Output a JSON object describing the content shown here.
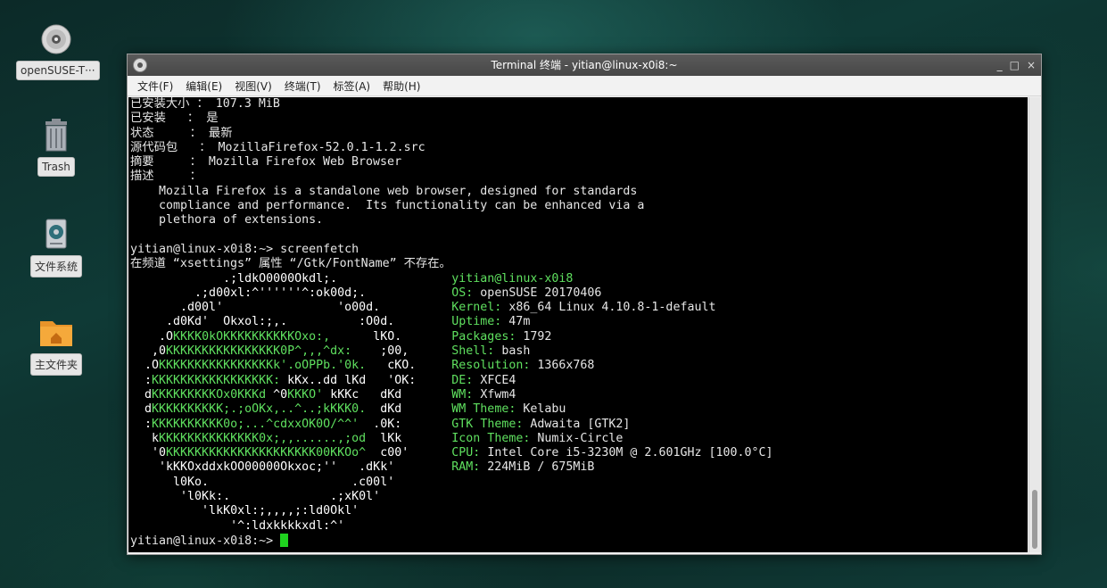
{
  "desktop": {
    "icons": [
      {
        "label": "openSUSE-T···",
        "icon": "disc-icon"
      },
      {
        "label": "Trash",
        "icon": "trash-icon"
      },
      {
        "label": "文件系统",
        "icon": "drive-icon"
      },
      {
        "label": "主文件夹",
        "icon": "home-folder-icon"
      }
    ]
  },
  "window": {
    "title": "Terminal 终端 - yitian@linux-x0i8:~",
    "controls": {
      "minimize": "_",
      "maximize": "□",
      "close": "×"
    },
    "menu": [
      "文件(F)",
      "编辑(E)",
      "视图(V)",
      "终端(T)",
      "标签(A)",
      "帮助(H)"
    ]
  },
  "terminal": {
    "info": [
      "已安装大小 ： 107.3 MiB",
      "已安装   ： 是",
      "状态     ： 最新",
      "源代码包   ： MozillaFirefox-52.0.1-1.2.src",
      "摘要     ： Mozilla Firefox Web Browser",
      "描述     ：",
      "    Mozilla Firefox is a standalone web browser, designed for standards",
      "    compliance and performance.  Its functionality can be enhanced via a",
      "    plethora of extensions.",
      ""
    ],
    "command_line": "yitian@linux-x0i8:~> screenfetch",
    "warning": "在频道 “xsettings” 属性 “/Gtk/FontName” 不存在。",
    "logo": [
      "             .;ldkO0000Okdl;.",
      "         .;d00xl:^''''''^:ok00d;.",
      "       .d00l'                'o00d.",
      "     .d0Kd'  Okxol:;,.          :O0d.",
      "    .OKKKK0kOKKKKKKKKKKOxo:,      lKO.",
      "   ,0KKKKKKKKKKKKKKKK0P^,,,^dx:    ;00,",
      "  .OKKKKKKKKKKKKKKKKk'.oOPPb.'0k.   cKO.",
      "  :KKKKKKKKKKKKKKKKK: kKx..dd lKd   'OK:",
      "  dKKKKKKKKKOx0KKKd ^0KKKO' kKKc   dKd",
      "  dKKKKKKKKKK;.;oOKx,..^..;kKKK0.  dKd",
      "  :KKKKKKKKKK0o;...^cdxxOK0O/^^'  .0K:",
      "   kKKKKKKKKKKKKKK0x;,,......,;od  lKk",
      "   '0KKKKKKKKKKKKKKKKKKKKK00KKOo^  c00'",
      "    'kKKOxddxkOO00000Okxoc;''   .dKk'",
      "      l0Ko.                    .c00l'",
      "       'l0Kk:.              .;xK0l'",
      "          'lkK0xl:;,,,,;:ld0Okl'",
      "              '^:ldxkkkkxdl:^'"
    ],
    "specs": [
      {
        "key": "",
        "value": "yitian@linux-x0i8"
      },
      {
        "key": "OS:",
        "value": " openSUSE 20170406"
      },
      {
        "key": "Kernel:",
        "value": " x86_64 Linux 4.10.8-1-default"
      },
      {
        "key": "Uptime:",
        "value": " 47m"
      },
      {
        "key": "Packages:",
        "value": " 1792"
      },
      {
        "key": "Shell:",
        "value": " bash"
      },
      {
        "key": "Resolution:",
        "value": " 1366x768"
      },
      {
        "key": "DE:",
        "value": " XFCE4"
      },
      {
        "key": "WM:",
        "value": " Xfwm4"
      },
      {
        "key": "WM Theme:",
        "value": " Kelabu"
      },
      {
        "key": "GTK Theme:",
        "value": " Adwaita [GTK2]"
      },
      {
        "key": "Icon Theme:",
        "value": " Numix-Circle"
      },
      {
        "key": "CPU:",
        "value": " Intel Core i5-3230M @ 2.601GHz [100.0°C]"
      },
      {
        "key": "RAM:",
        "value": " 224MiB / 675MiB"
      }
    ],
    "prompt": "yitian@linux-x0i8:~> ",
    "colors": {
      "accent_green": "#5fe05f",
      "cursor": "#1fd21f"
    }
  }
}
